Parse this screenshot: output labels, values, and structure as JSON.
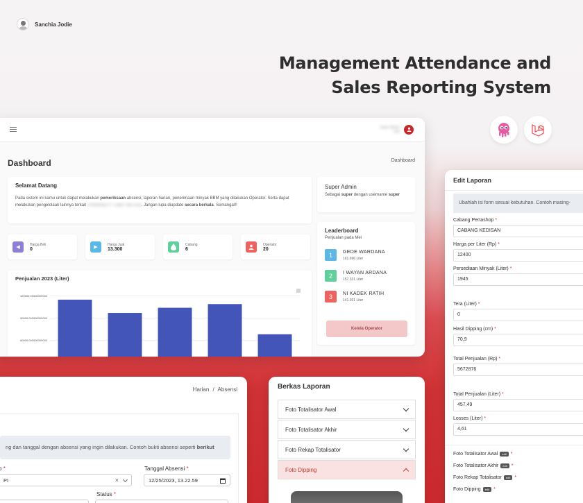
{
  "user": {
    "name": "Sanchia Jodie"
  },
  "hero": {
    "line1": "Management Attendance and",
    "line2": "Sales Reporting System"
  },
  "dashboard": {
    "topbar": {
      "user_name": "Super Admin",
      "user_role": "Lalu"
    },
    "title": "Dashboard",
    "breadcrumb": "Dashboard",
    "welcome": {
      "title": "Selamat Datang",
      "p1": "Pada sistem ini kamu untuk dapat melakukan ",
      "b1": "pemeriksaan",
      "p2": " absensi, laporan harian, penerimaan minyak BBM yang dilakukan Operator. Serta dapat melakukan pengelolaan lainnya terkait ",
      "hidden": "Pertashop PT Catur Sari Dua",
      "p3": ". Jangan lupa diupdate ",
      "b2": "secara berkala",
      "p4": ". Semangat!!"
    },
    "super_admin": {
      "title": "Super Admin",
      "p1": "Sebagai ",
      "b1": "super",
      "p2": " dengan username ",
      "b2": "super"
    },
    "stats": [
      {
        "label": "Harga Beli",
        "value": "0",
        "color": "#8e7fd6",
        "icon": "arrow-left-icon"
      },
      {
        "label": "Harga Jual",
        "value": "13.300",
        "color": "#5bb8e6",
        "icon": "arrow-right-icon"
      },
      {
        "label": "Cabang",
        "value": "6",
        "color": "#5fcf9b",
        "icon": "drop-icon"
      },
      {
        "label": "Operator",
        "value": "20",
        "color": "#f0635c",
        "icon": "user-icon"
      }
    ],
    "leaderboard": {
      "title": "Leaderboard",
      "subtitle": "Penjualan pada Mei",
      "items": [
        {
          "rank": "1",
          "name": "GEDE WARDANA",
          "value": "161.696 Liter",
          "color": "#5bb8e6"
        },
        {
          "rank": "2",
          "name": "I WAYAN ARDANA",
          "value": "157.331 Liter",
          "color": "#5fcf9b"
        },
        {
          "rank": "3",
          "name": "NI KADEK RATIH",
          "value": "141.031 Liter",
          "color": "#f0635c"
        }
      ],
      "button": "Kelola Operator"
    }
  },
  "chart_data": {
    "type": "bar",
    "title": "Penjualan 2023 (Liter)",
    "ytick_labels": [
      "120000.00000000000",
      "90000.000000000000",
      "60000.000000000000",
      "30000.000000000000"
    ],
    "yticks": [
      120000,
      90000,
      60000,
      30000
    ],
    "values": [
      115000,
      97000,
      104000,
      109000,
      68000
    ],
    "ylim": [
      0,
      130000
    ],
    "bar_color": "#4355b9"
  },
  "absensi": {
    "breadcrumb_a": "Harian",
    "breadcrumb_sep": "/",
    "breadcrumb_b": "Absensi",
    "notice_a": "ng dan tanggal dengan absensi yang ingin dilakukan. Contoh bukti absensi seperti ",
    "notice_b": "berikut",
    "field1_label": "p",
    "field1_value": "PI",
    "date_label": "Tanggal Absensi",
    "date_value": "12/25/2023, 13.22.59",
    "status_label": "Status"
  },
  "berkas": {
    "title": "Berkas Laporan",
    "items": [
      "Foto Totalisator Awal",
      "Foto Totalisator Akhir",
      "Foto Rekap Totalisator",
      "Foto Dipping"
    ]
  },
  "edit": {
    "title": "Edit Laporan",
    "notice": "Ubahlah isi form sesuai kebutuhan. Contoh masing-",
    "fields": [
      {
        "label": "Cabang Pertashop",
        "value": "CABANG KEDISAN"
      },
      {
        "label": "Harga per Liter (Rp)",
        "value": "12400"
      },
      {
        "label": "Persediaan Minyak (Liter)",
        "value": "1945"
      },
      {
        "label": "Tera (Liter)",
        "value": "0"
      },
      {
        "label": "Hasil Dipping (cm)",
        "value": "70,9"
      },
      {
        "label": "Total Penjualan (Rp)",
        "value": "5672876"
      },
      {
        "label": "Total Penjualan (Liter)",
        "value": "457,49"
      },
      {
        "label": "Losses (Liter)",
        "value": "4,61"
      }
    ],
    "photos": [
      "Foto Totalisator Awal",
      "Foto Totalisator Akhir",
      "Foto Rekap Totalisator",
      "Foto Dipping"
    ],
    "badge": "edit",
    "required": "*"
  }
}
